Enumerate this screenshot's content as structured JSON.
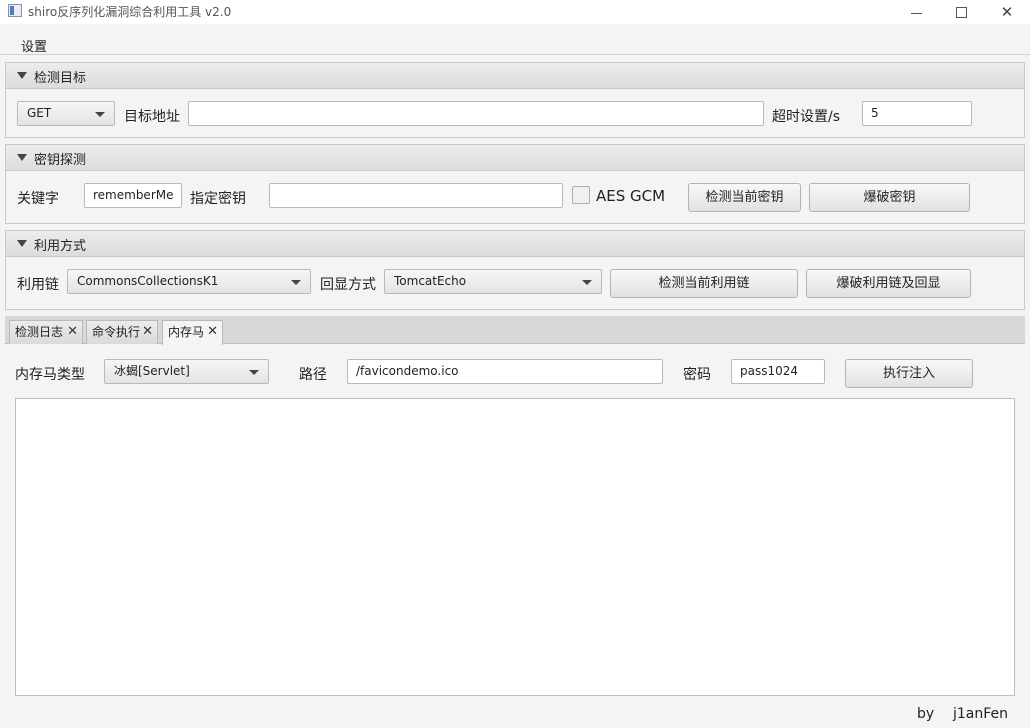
{
  "window": {
    "title": "shiro反序列化漏洞综合利用工具 v2.0",
    "close_glyph": "✕"
  },
  "menu": {
    "settings": "设置"
  },
  "target_pane": {
    "title": "检测目标",
    "method": "GET",
    "url_label": "目标地址",
    "url_value": "",
    "timeout_label": "超时设置/s",
    "timeout_value": "5"
  },
  "key_pane": {
    "title": "密钥探测",
    "keyword_label": "关键字",
    "keyword_value": "rememberMe",
    "key_label": "指定密钥",
    "key_value": "",
    "aes_gcm_label": "AES GCM",
    "aes_gcm_checked": false,
    "check_key_button": "检测当前密钥",
    "brute_key_button": "爆破密钥"
  },
  "exploit_pane": {
    "title": "利用方式",
    "chain_label": "利用链",
    "chain_value": "CommonsCollectionsK1",
    "echo_label": "回显方式",
    "echo_value": "TomcatEcho",
    "check_chain_button": "检测当前利用链",
    "brute_chain_button": "爆破利用链及回显"
  },
  "tabs": [
    {
      "label": "检测日志",
      "close": "✕"
    },
    {
      "label": "命令执行",
      "close": "✕"
    },
    {
      "label": "内存马",
      "close": "✕",
      "active": true
    }
  ],
  "memshell": {
    "type_label": "内存马类型",
    "type_value": "冰蝎[Servlet]",
    "path_label": "路径",
    "path_value": "/favicondemo.ico",
    "password_label": "密码",
    "password_value": "pass1024",
    "inject_button": "执行注入",
    "output_text": ""
  },
  "footer": {
    "by": "by",
    "author": "j1anFen"
  },
  "colors": {
    "background": "#f4f4f4",
    "pane_header": "#dcdcdc",
    "border": "#c9c9c9"
  }
}
